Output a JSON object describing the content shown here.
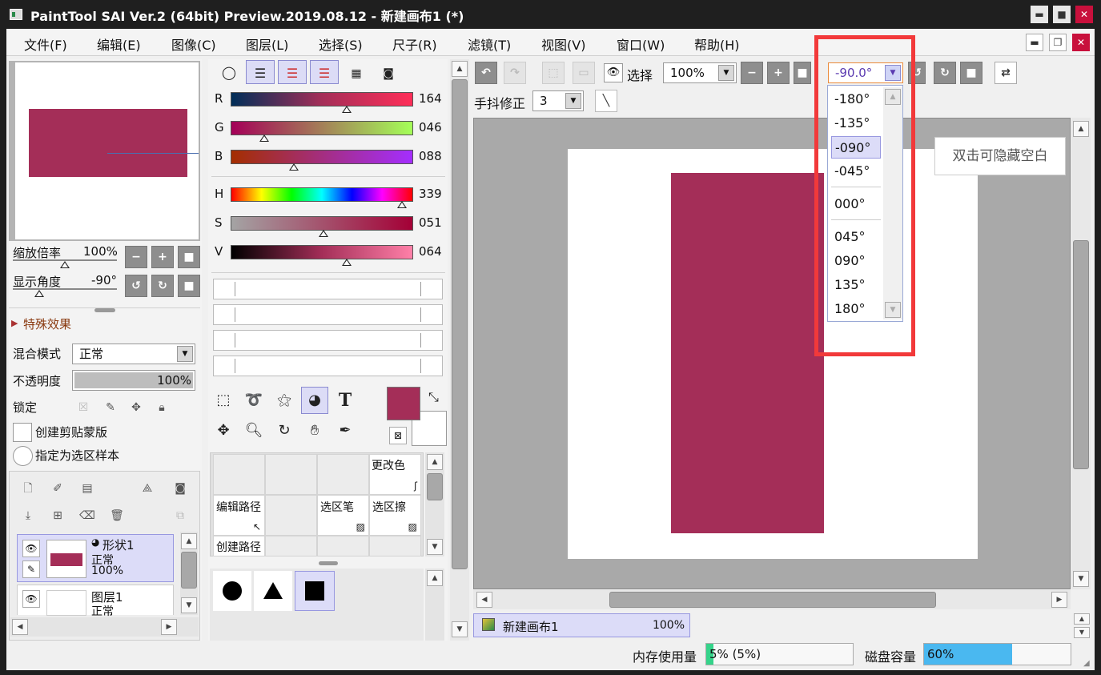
{
  "window": {
    "title": "PaintTool SAI Ver.2 (64bit) Preview.2019.08.12 - 新建画布1 (*)",
    "min": "▬",
    "max": "■",
    "close": "✕"
  },
  "menu": [
    "文件(F)",
    "编辑(E)",
    "图像(C)",
    "图层(L)",
    "选择(S)",
    "尺子(R)",
    "滤镜(T)",
    "视图(V)",
    "窗口(W)",
    "帮助(H)"
  ],
  "mdi": {
    "min": "▬",
    "restore": "❐",
    "close": "✕"
  },
  "navigator": {
    "zoom_label": "缩放倍率",
    "zoom_value": "100%",
    "angle_label": "显示角度",
    "angle_value": "-90°",
    "btn_minus": "−",
    "btn_plus": "+",
    "btn_reset": "■",
    "btn_rot_ccw": "↺",
    "btn_rot_cw": "↻"
  },
  "layer_props": {
    "effects_label": "特殊效果",
    "blend_label": "混合模式",
    "blend_value": "正常",
    "opacity_label": "不透明度",
    "opacity_value": "100%",
    "lock_label": "锁定",
    "clip_label": "创建剪贴蒙版",
    "sample_label": "指定为选区样本"
  },
  "layers": [
    {
      "name": "形状1",
      "mode": "正常",
      "opacity": "100%"
    },
    {
      "name": "图层1",
      "mode": "正常"
    }
  ],
  "color": {
    "R": {
      "label": "R",
      "value": "164"
    },
    "G": {
      "label": "G",
      "value": "046"
    },
    "B": {
      "label": "B",
      "value": "088"
    },
    "H": {
      "label": "H",
      "value": "339"
    },
    "S": {
      "label": "S",
      "value": "051"
    },
    "V": {
      "label": "V",
      "value": "064"
    },
    "main_color": "#a42e58"
  },
  "tools": {
    "text_tool": "T",
    "grid": {
      "change_color": "更改色",
      "edit_path": "编辑路径",
      "select_pen": "选区笔",
      "select_eraser": "选区擦",
      "create_path": "创建路径"
    }
  },
  "canvas_toolbar": {
    "select_label": "选择",
    "zoom_value": "100%",
    "angle_value": "-90.0°",
    "stabilizer_label": "手抖修正",
    "stabilizer_value": "3"
  },
  "angle_dropdown": [
    "-180°",
    "-135°",
    "-090°",
    "-045°",
    "000°",
    "045°",
    "090°",
    "135°",
    "180°"
  ],
  "canvas": {
    "tooltip": "双击可隐藏空白",
    "shape_color": "#a42e58"
  },
  "doc_tab": {
    "name": "新建画布1",
    "zoom": "100%"
  },
  "status": {
    "mem_label": "内存使用量",
    "mem_value": "5% (5%)",
    "mem_level": 0.05,
    "disk_label": "磁盘容量",
    "disk_value": "60%",
    "disk_level": 0.6
  },
  "highlight_color": "#f2393a"
}
